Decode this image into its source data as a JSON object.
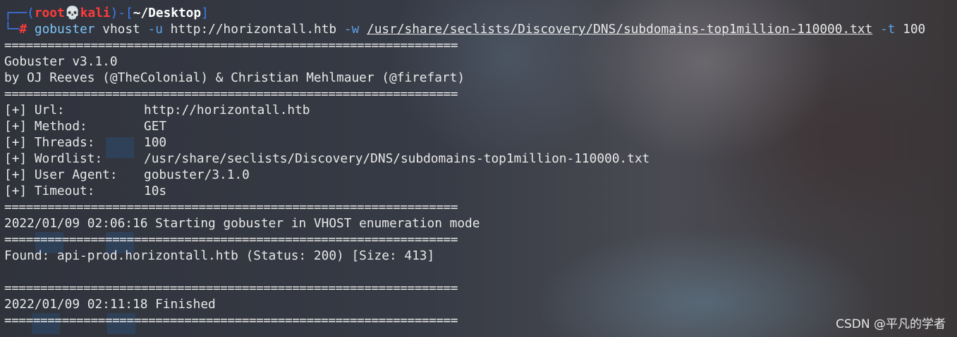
{
  "prompt": {
    "frame_top_left": "┌──(",
    "user": "root💀kali",
    "frame_mid": ")-[",
    "dir": "~/Desktop",
    "frame_end": "]",
    "frame_bottom": "└─",
    "hash": "#"
  },
  "command": {
    "name": "gobuster",
    "mode": "vhost",
    "flag_u": "-u",
    "url": "http://horizontall.htb",
    "flag_w": "-w",
    "wordlist": "/usr/share/seclists/Discovery/DNS/subdomains-top1million-110000.txt",
    "flag_t": "-t",
    "threads": "100"
  },
  "separator": "===============================================================",
  "banner": {
    "title": "Gobuster v3.1.0",
    "authors": "by OJ Reeves (@TheColonial) & Christian Mehlmauer (@firefart)"
  },
  "settings": [
    {
      "key": "[+] Url:",
      "value": "http://horizontall.htb"
    },
    {
      "key": "[+] Method:",
      "value": "GET"
    },
    {
      "key": "[+] Threads:",
      "value": "100"
    },
    {
      "key": "[+] Wordlist:",
      "value": "/usr/share/seclists/Discovery/DNS/subdomains-top1million-110000.txt"
    },
    {
      "key": "[+] User Agent:",
      "value": "gobuster/3.1.0"
    },
    {
      "key": "[+] Timeout:",
      "value": "10s"
    }
  ],
  "start_message": "2022/01/09 02:06:16 Starting gobuster in VHOST enumeration mode",
  "found": "Found: api-prod.horizontall.htb (Status: 200) [Size: 413]",
  "finish_message": "2022/01/09 02:11:18 Finished",
  "watermark": "CSDN @平凡的学者"
}
